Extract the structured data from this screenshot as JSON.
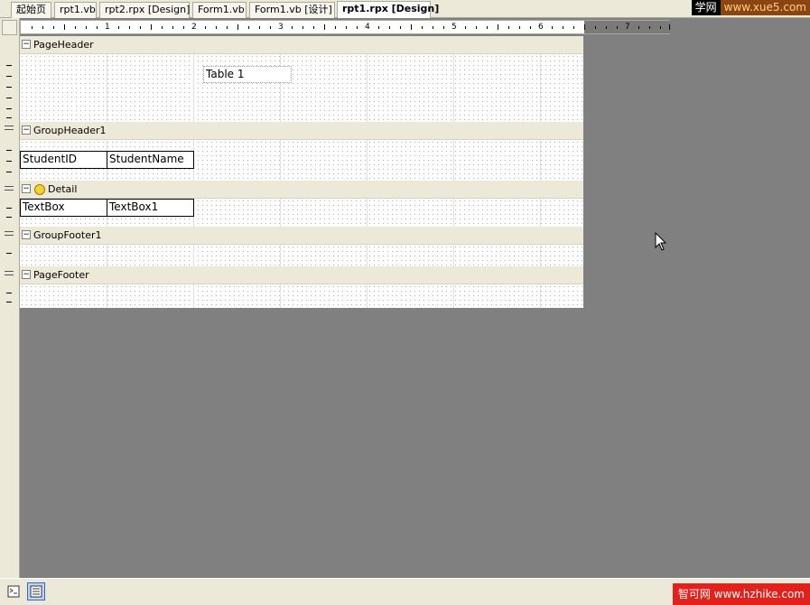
{
  "tabs": [
    {
      "label": "起始页"
    },
    {
      "label": "rpt1.vb"
    },
    {
      "label": "rpt2.rpx [Design]"
    },
    {
      "label": "Form1.vb"
    },
    {
      "label": "Form1.vb [设计]"
    },
    {
      "label": "rpt1.rpx [Design]",
      "active": true
    }
  ],
  "watermark_top": {
    "left": "学网",
    "right": "www.xue5.com"
  },
  "ruler": {
    "numbers": [
      "1",
      "2",
      "3",
      "4",
      "5",
      "6",
      "7"
    ]
  },
  "sections": {
    "page_header": {
      "label": "PageHeader",
      "title_text": "Table 1"
    },
    "group_header": {
      "label": "GroupHeader1",
      "col1": "StudentID",
      "col2": "StudentName"
    },
    "detail": {
      "label": "Detail",
      "col1": "TextBox",
      "col2": "TextBox1"
    },
    "group_footer": {
      "label": "GroupFooter1"
    },
    "page_footer": {
      "label": "PageFooter"
    }
  },
  "watermark_bottom": "智可网 www.hzhike.com",
  "colors": {
    "chrome": "#ECE9D8",
    "workspace": "#808080",
    "surface": "#FFFFFF",
    "watermark_red": "#E2211C"
  },
  "icons": [
    "collapse-icon",
    "detail-band-icon",
    "mouse-cursor-icon",
    "script-view-icon",
    "design-view-icon"
  ]
}
